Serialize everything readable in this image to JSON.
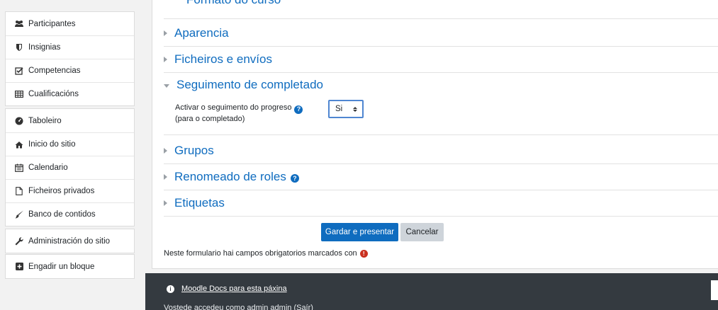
{
  "sidebar": {
    "group1": [
      {
        "label": "Participantes",
        "icon": "users-icon"
      },
      {
        "label": "Insignias",
        "icon": "shield-icon"
      },
      {
        "label": "Competencias",
        "icon": "checkbox-icon"
      },
      {
        "label": "Cualificacións",
        "icon": "table-icon"
      }
    ],
    "group2": [
      {
        "label": "Taboleiro",
        "icon": "dashboard-icon"
      },
      {
        "label": "Inicio do sitio",
        "icon": "home-icon"
      },
      {
        "label": "Calendario",
        "icon": "calendar-icon"
      },
      {
        "label": "Ficheiros privados",
        "icon": "file-icon"
      },
      {
        "label": "Banco de contidos",
        "icon": "paintbrush-icon"
      }
    ],
    "group3": [
      {
        "label": "Administración do sitio",
        "icon": "wrench-icon"
      }
    ],
    "group4": [
      {
        "label": "Engadir un bloque",
        "icon": "plus-square-icon"
      }
    ]
  },
  "form": {
    "cut_section_title": "Formato do curso",
    "sections": {
      "appearance": "Aparencia",
      "files": "Ficheiros e envíos",
      "completion": "Seguimento de completado",
      "groups": "Grupos",
      "roles": "Renomeado de roles",
      "tags": "Etiquetas"
    },
    "completion_field": {
      "label_line1": "Activar o seguimento do progreso",
      "label_line2": "(para o completado)",
      "value": "Si"
    },
    "help_glyph": "?",
    "buttons": {
      "save": "Gardar e presentar",
      "cancel": "Cancelar"
    },
    "required_note": "Neste formulario hai campos obrigatorios marcados con",
    "required_glyph": "!"
  },
  "footer": {
    "info_glyph": "i",
    "docs_link": "Moodle Docs para esta páxina",
    "login_text": "Vostede accedeu como admin admin (Saír)"
  },
  "colors": {
    "link": "#0f6cbf",
    "primary": "#0f6cbf",
    "footer_bg": "#343a40",
    "required": "#ca3120"
  }
}
